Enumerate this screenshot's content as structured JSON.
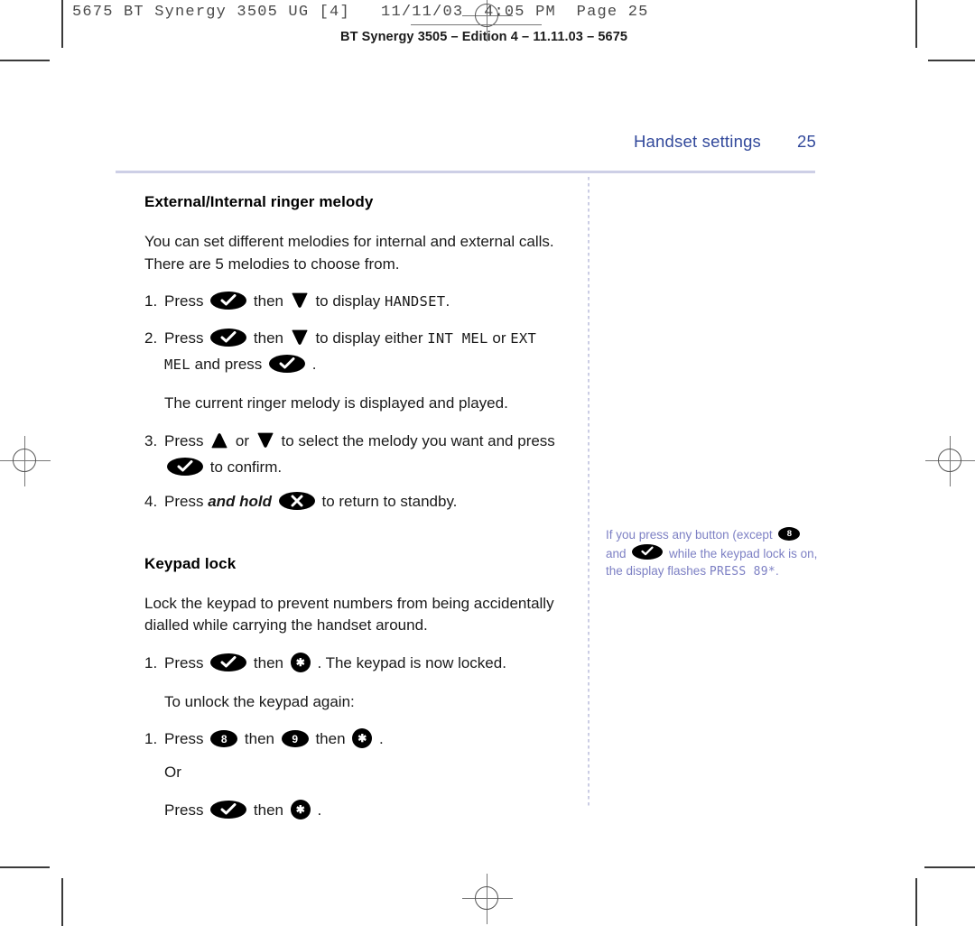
{
  "print_marks": {
    "slug_line": "5675 BT Synergy 3505 UG [4]   11/11/03  4:05 PM  Page 25",
    "edition_line": "BT Synergy 3505 – Edition 4 – 11.11.03 – 5675"
  },
  "running_head": {
    "title": "Handset settings",
    "page_number": "25",
    "color": "#32499b"
  },
  "colors": {
    "heading_blue": "#32499b",
    "rule_lavender": "#cdcfe6",
    "side_note_purple": "#7d80c4",
    "body_black": "#1a1a1a"
  },
  "sections": [
    {
      "heading": "External/Internal ringer melody",
      "intro": "You can set different melodies for internal and external calls. There are 5 melodies to choose from.",
      "steps": [
        {
          "num": "1.",
          "parts": [
            {
              "t": "text",
              "v": "Press "
            },
            {
              "t": "key",
              "icon": "check-key"
            },
            {
              "t": "text",
              "v": " then "
            },
            {
              "t": "key",
              "icon": "down-arrow-key"
            },
            {
              "t": "text",
              "v": " to display "
            },
            {
              "t": "lcd",
              "v": "HANDSET"
            },
            {
              "t": "text",
              "v": "."
            }
          ]
        },
        {
          "num": "2.",
          "parts": [
            {
              "t": "text",
              "v": "Press "
            },
            {
              "t": "key",
              "icon": "check-key"
            },
            {
              "t": "text",
              "v": " then "
            },
            {
              "t": "key",
              "icon": "down-arrow-key"
            },
            {
              "t": "text",
              "v": " to display either "
            },
            {
              "t": "lcd",
              "v": "INT MEL"
            },
            {
              "t": "text",
              "v": " or "
            },
            {
              "t": "lcd",
              "v": "EXT MEL"
            },
            {
              "t": "text",
              "v": " and press "
            },
            {
              "t": "key",
              "icon": "check-key"
            },
            {
              "t": "text",
              "v": " ."
            }
          ]
        }
      ],
      "interstitial": "The current ringer melody is displayed and played.",
      "steps2": [
        {
          "num": "3.",
          "parts": [
            {
              "t": "text",
              "v": "Press "
            },
            {
              "t": "key",
              "icon": "up-arrow-key"
            },
            {
              "t": "text",
              "v": " or "
            },
            {
              "t": "key",
              "icon": "down-arrow-key"
            },
            {
              "t": "text",
              "v": " to select the melody you want and press "
            },
            {
              "t": "key",
              "icon": "check-key"
            },
            {
              "t": "text",
              "v": " to confirm."
            }
          ]
        },
        {
          "num": "4.",
          "parts": [
            {
              "t": "text",
              "v": "Press "
            },
            {
              "t": "bolditalic",
              "v": "and hold"
            },
            {
              "t": "text",
              "v": " "
            },
            {
              "t": "key",
              "icon": "cancel-key"
            },
            {
              "t": "text",
              "v": " to return to standby."
            }
          ]
        }
      ]
    },
    {
      "heading": "Keypad lock",
      "intro": "Lock the keypad to prevent numbers from being accidentally dialled while carrying the handset around.",
      "steps": [
        {
          "num": "1.",
          "parts": [
            {
              "t": "text",
              "v": "Press "
            },
            {
              "t": "key",
              "icon": "check-key"
            },
            {
              "t": "text",
              "v": " then "
            },
            {
              "t": "key",
              "icon": "star-key"
            },
            {
              "t": "text",
              "v": " . The keypad is now locked."
            }
          ]
        }
      ],
      "interstitial": "To unlock the keypad again:",
      "steps2": [
        {
          "num": "1.",
          "parts": [
            {
              "t": "text",
              "v": "Press "
            },
            {
              "t": "key",
              "icon": "eight-key"
            },
            {
              "t": "text",
              "v": " then "
            },
            {
              "t": "key",
              "icon": "nine-key"
            },
            {
              "t": "text",
              "v": " then "
            },
            {
              "t": "key",
              "icon": "star-key"
            },
            {
              "t": "text",
              "v": " ."
            }
          ]
        }
      ],
      "or_label": "Or",
      "steps3": [
        {
          "num": "",
          "parts": [
            {
              "t": "text",
              "v": "Press "
            },
            {
              "t": "key",
              "icon": "check-key"
            },
            {
              "t": "text",
              "v": " then "
            },
            {
              "t": "key",
              "icon": "star-key"
            },
            {
              "t": "text",
              "v": " ."
            }
          ]
        }
      ]
    }
  ],
  "side_note": {
    "parts": [
      {
        "t": "text",
        "v": "If you press any button (except "
      },
      {
        "t": "key",
        "icon": "eight-key"
      },
      {
        "t": "text",
        "v": " and "
      },
      {
        "t": "key",
        "icon": "check-key"
      },
      {
        "t": "text",
        "v": " while the keypad lock is on, the display flashes "
      },
      {
        "t": "lcd",
        "v": "PRESS 89"
      },
      {
        "t": "lcd",
        "v": "*"
      },
      {
        "t": "text",
        "v": "."
      }
    ]
  },
  "key_glyphs": {
    "check-key": "✔",
    "cancel-key": "✖",
    "star-key": "✱",
    "up-arrow-key": "▲",
    "down-arrow-key": "▼",
    "eight-key": "8",
    "nine-key": "9"
  }
}
